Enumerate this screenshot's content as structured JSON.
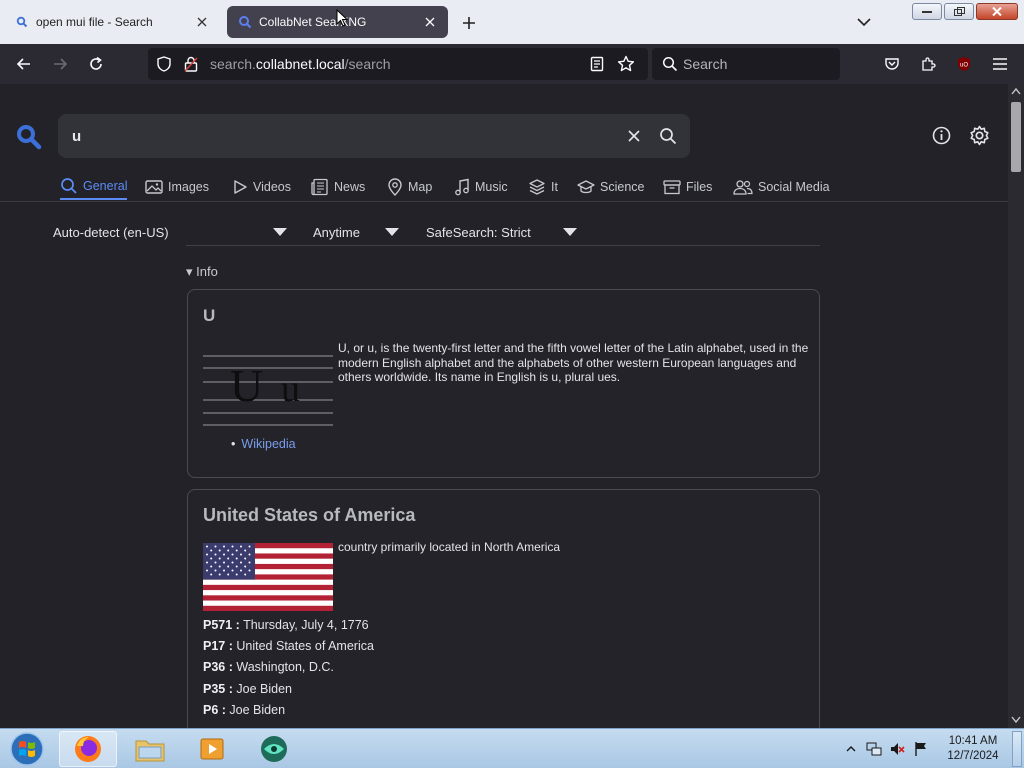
{
  "browser": {
    "tabs": [
      {
        "title": "open mui file - Search"
      },
      {
        "title": "CollabNet SearXNG"
      }
    ],
    "url": {
      "scheme_prefix": "search.",
      "host": "collabnet.local",
      "path": "/search"
    },
    "search_placeholder": "Search"
  },
  "search": {
    "query": "u",
    "categories": [
      {
        "label": "General",
        "active": true
      },
      {
        "label": "Images"
      },
      {
        "label": "Videos"
      },
      {
        "label": "News"
      },
      {
        "label": "Map"
      },
      {
        "label": "Music"
      },
      {
        "label": "It"
      },
      {
        "label": "Science"
      },
      {
        "label": "Files"
      },
      {
        "label": "Social Media"
      }
    ],
    "filters": {
      "language": "Auto-detect (en-US)",
      "time": "Anytime",
      "safesearch": "SafeSearch: Strict"
    }
  },
  "info_section": {
    "toggle_label": "▾ Info",
    "cards": [
      {
        "title": "U",
        "description": "U, or u, is the twenty-first letter and the fifth vowel letter of the Latin alphabet, used in the modern English alphabet and the alphabets of other western European languages and others worldwide. Its name in English is u, plural ues.",
        "image_letters": "U u",
        "links": [
          {
            "label": "Wikipedia"
          }
        ]
      },
      {
        "title": "United States of America",
        "description": "country primarily located in North America",
        "properties": [
          {
            "key": "P571 :",
            "value": "Thursday, July 4, 1776"
          },
          {
            "key": "P17 :",
            "value": "United States of America"
          },
          {
            "key": "P36 :",
            "value": "Washington, D.C."
          },
          {
            "key": "P35 :",
            "value": "Joe Biden"
          },
          {
            "key": "P6 :",
            "value": "Joe Biden"
          }
        ]
      }
    ]
  },
  "taskbar": {
    "clock_time": "10:41 AM",
    "clock_date": "12/7/2024"
  },
  "colors": {
    "accent": "#5b8cf5",
    "link": "#7a9dec",
    "page_bg": "#222228",
    "toolbar_bg": "#2b2a33"
  }
}
